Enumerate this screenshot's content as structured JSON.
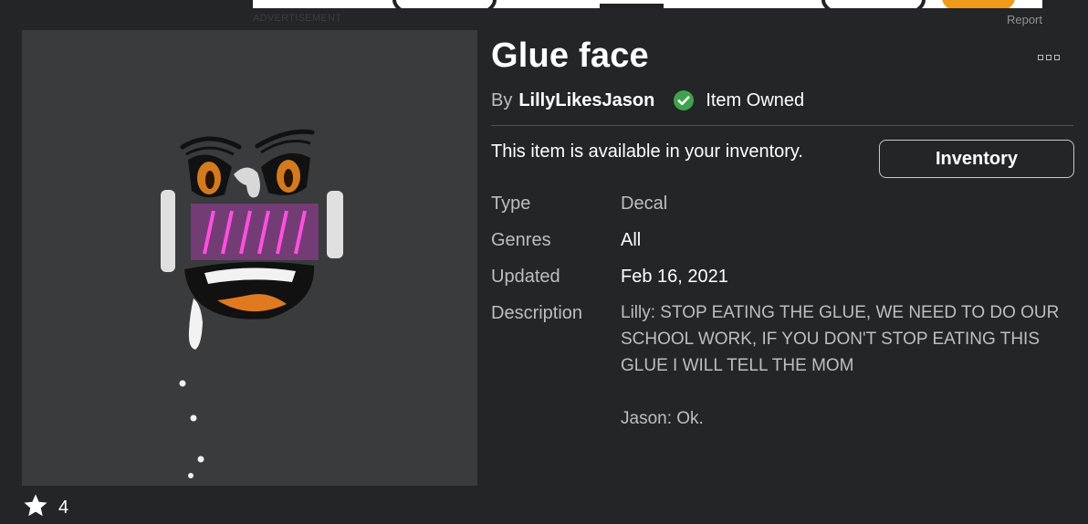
{
  "ad": {
    "label": "ADVERTISEMENT",
    "report": "Report"
  },
  "item": {
    "title": "Glue face",
    "by_label": "By",
    "creator": "LillyLikesJason",
    "owned_label": "Item Owned",
    "availability": "This item is available in your inventory.",
    "inventory_button": "Inventory",
    "favorites": "4"
  },
  "details": {
    "type_label": "Type",
    "type_value": "Decal",
    "genres_label": "Genres",
    "genres_value": "All",
    "updated_label": "Updated",
    "updated_value": "Feb 16, 2021",
    "description_label": "Description",
    "description_value": "Lilly: STOP EATING THE GLUE, WE NEED TO DO OUR SCHOOL WORK, IF YOU DON'T STOP EATING THIS GLUE I WILL TELL THE MOM\n\nJason: Ok."
  },
  "colors": {
    "background": "#232527",
    "thumbnail_bg": "#393b3d",
    "verified_green": "#3fa34d",
    "face_magenta": "#d94fd0"
  },
  "icons": [
    "more-options-icon",
    "verified-check-icon",
    "star-icon"
  ]
}
